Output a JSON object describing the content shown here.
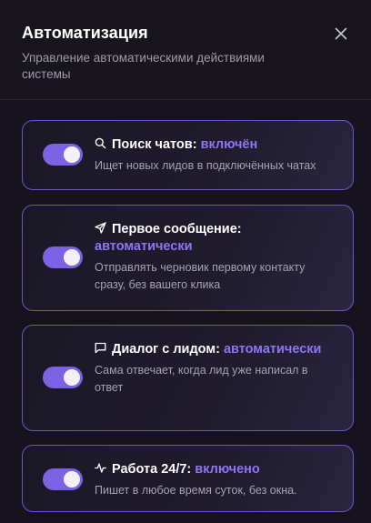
{
  "header": {
    "title": "Автоматизация",
    "subtitle": "Управление автоматическими действиями системы"
  },
  "automations": [
    {
      "icon": "search-icon",
      "label": "Поиск чатов:",
      "state": "включён",
      "description": "Ищет новых лидов в подключённых чатах",
      "enabled": true
    },
    {
      "icon": "send-icon",
      "label": "Первое сообщение:",
      "state": "автоматически",
      "description": "Отправлять черновик первому контакту сразу, без вашего клика",
      "enabled": true
    },
    {
      "icon": "message-square-icon",
      "label": "Диалог с лидом:",
      "state": "автоматически",
      "description": "Сама отвечает, когда лид уже написал в ответ",
      "enabled": true
    },
    {
      "icon": "activity-icon",
      "label": "Работа 24/7:",
      "state": "включено",
      "description": "Пишет в любое время суток, без окна.",
      "enabled": true
    }
  ],
  "colors": {
    "background": "#16131f",
    "accent": "#7c63e6",
    "state_text": "#8f74f4",
    "card_border": "#6a55c9",
    "muted_text": "#a6a2b3"
  }
}
